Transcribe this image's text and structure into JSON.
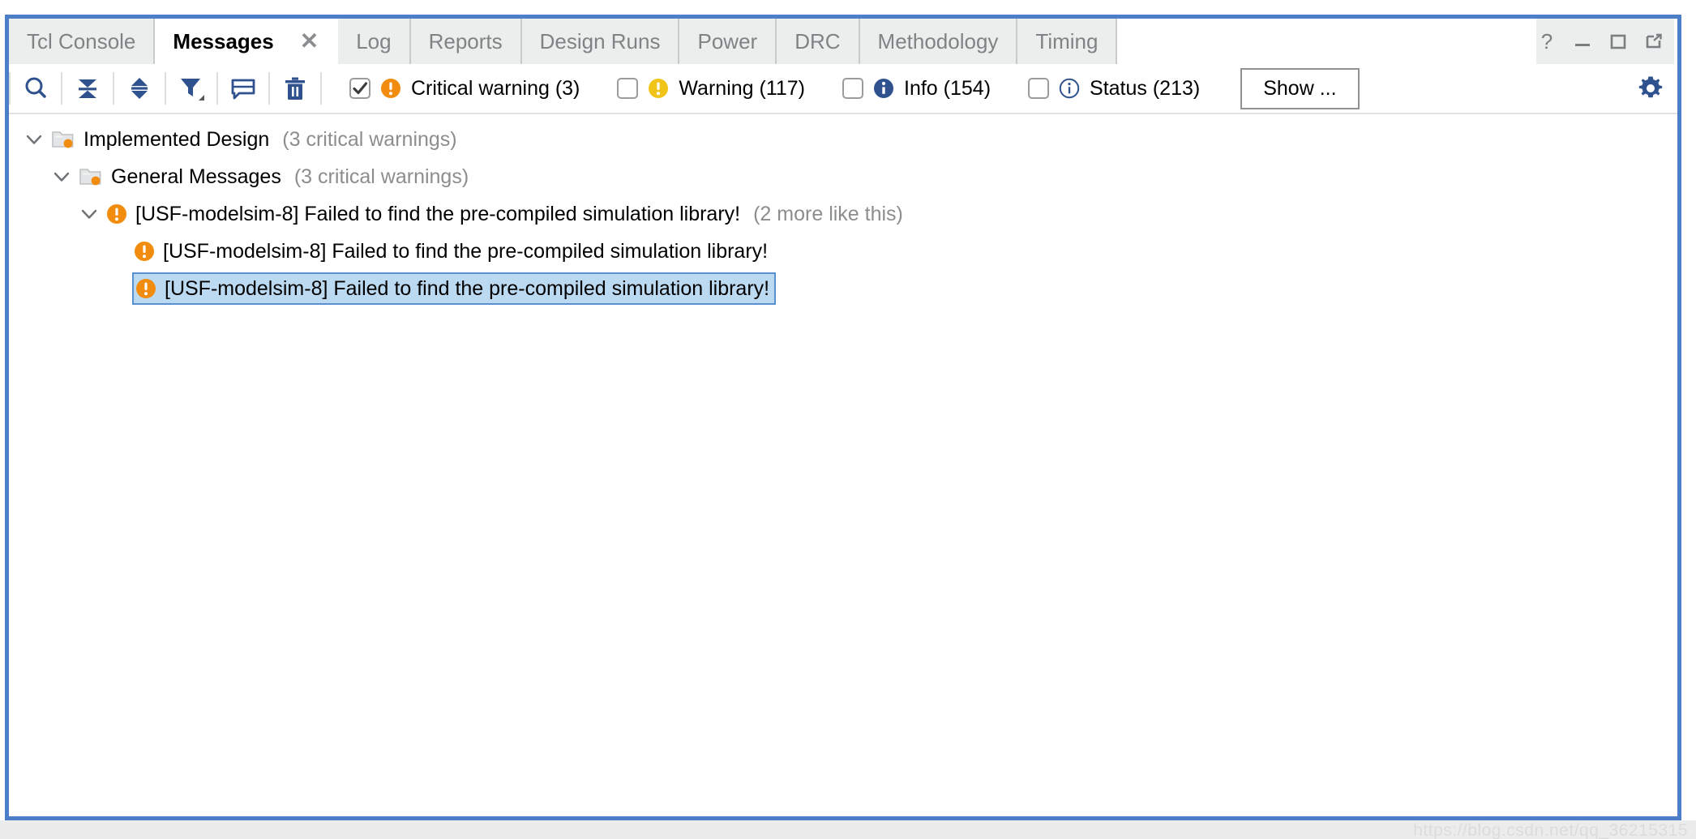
{
  "window": {
    "controls": [
      {
        "name": "help-button",
        "glyph": "?"
      },
      {
        "name": "minimize-button",
        "glyph": "—"
      },
      {
        "name": "maximize-button",
        "glyph": "▢"
      },
      {
        "name": "float-button",
        "glyph": "⇱"
      }
    ]
  },
  "tabs": [
    {
      "label": "Tcl Console",
      "active": false
    },
    {
      "label": "Messages",
      "active": true,
      "close": "✕"
    },
    {
      "label": "Log",
      "active": false
    },
    {
      "label": "Reports",
      "active": false
    },
    {
      "label": "Design Runs",
      "active": false
    },
    {
      "label": "Power",
      "active": false
    },
    {
      "label": "DRC",
      "active": false
    },
    {
      "label": "Methodology",
      "active": false
    },
    {
      "label": "Timing",
      "active": false
    }
  ],
  "toolbar": {
    "buttons": [
      {
        "name": "search-icon",
        "title": "Search"
      },
      {
        "name": "collapse-all-icon",
        "title": "Collapse All"
      },
      {
        "name": "expand-all-icon",
        "title": "Expand All"
      },
      {
        "name": "filter-icon",
        "title": "Filter"
      },
      {
        "name": "comment-icon",
        "title": "Comment"
      },
      {
        "name": "delete-icon",
        "title": "Delete"
      }
    ],
    "filters": [
      {
        "key": "critical-warning",
        "label": "Critical warning (3)",
        "checked": true,
        "severity": "critical-warning",
        "count": 3
      },
      {
        "key": "warning",
        "label": "Warning (117)",
        "checked": false,
        "severity": "warning",
        "count": 117
      },
      {
        "key": "info",
        "label": "Info (154)",
        "checked": false,
        "severity": "info",
        "count": 154
      },
      {
        "key": "status",
        "label": "Status (213)",
        "checked": false,
        "severity": "status",
        "count": 213
      }
    ],
    "show_button_label": "Show ...",
    "settings_icon": "gear-icon"
  },
  "tree": {
    "rows": [
      {
        "kind": "folder",
        "indent": 0,
        "expanded": true,
        "icon": "folder-critical-icon",
        "label": "Implemented Design",
        "sub": "(3 critical warnings)",
        "selected": false
      },
      {
        "kind": "folder",
        "indent": 1,
        "expanded": true,
        "icon": "folder-critical-icon",
        "label": "General Messages",
        "sub": "(3 critical warnings)",
        "selected": false
      },
      {
        "kind": "message",
        "indent": 2,
        "expanded": true,
        "icon": "critical-warning-icon",
        "label": "[USF-modelsim-8] Failed to find the pre-compiled simulation library!",
        "sub": "(2 more like this)",
        "selected": false
      },
      {
        "kind": "message",
        "indent": 3,
        "expanded": null,
        "icon": "critical-warning-icon",
        "label": "[USF-modelsim-8] Failed to find the pre-compiled simulation library!",
        "sub": "",
        "selected": false
      },
      {
        "kind": "message",
        "indent": 3,
        "expanded": null,
        "icon": "critical-warning-icon",
        "label": "[USF-modelsim-8] Failed to find the pre-compiled simulation library!",
        "sub": "",
        "selected": true
      }
    ]
  },
  "watermark": "https://blog.csdn.net/qq_36215315",
  "colors": {
    "panel_border": "#4d7fc9",
    "tab_inactive_bg": "#eceded",
    "tab_active_bg": "#ffffff",
    "tab_inactive_text": "#808285",
    "icon_blue": "#2f528f",
    "critical_warning": "#f28c0f",
    "warning": "#f0c419",
    "info": "#2f528f",
    "status": "#2f528f",
    "selection_bg": "#bcd9f2",
    "selection_border": "#5a8fd0",
    "muted_text": "#8b8d8f"
  }
}
